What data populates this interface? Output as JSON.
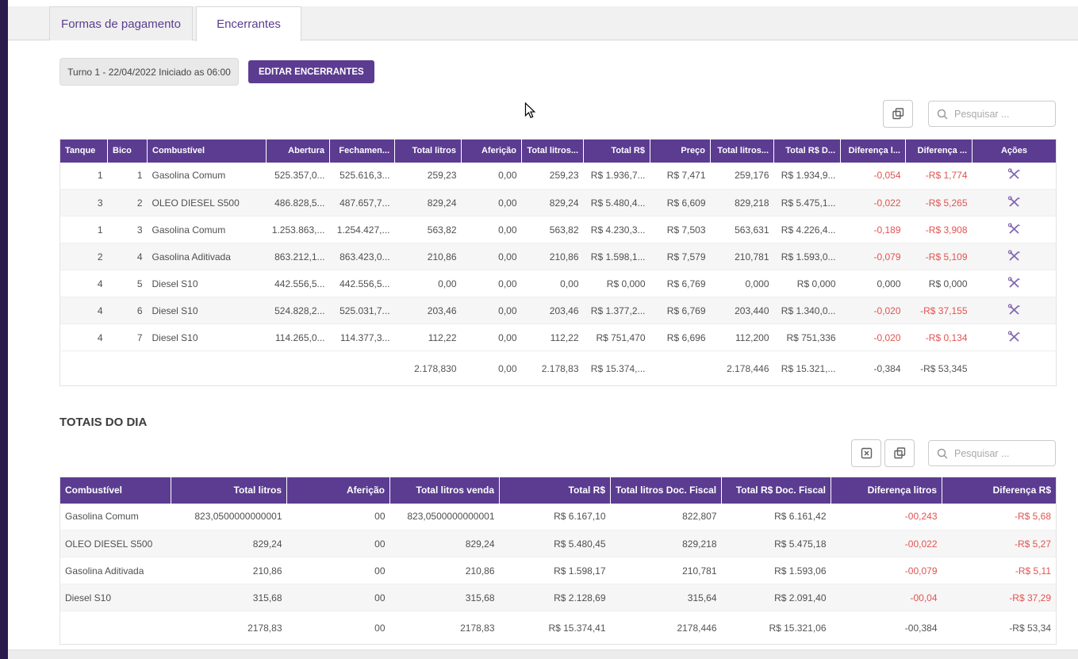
{
  "colors": {
    "accent": "#5b3c91",
    "negative": "#e05450",
    "leftbar": "#2b1b4d"
  },
  "tabs": [
    {
      "label": "Formas de pagamento",
      "active": false
    },
    {
      "label": "Encerrantes",
      "active": true
    }
  ],
  "header": {
    "shift_label": "Turno 1 - 22/04/2022 Iniciado as 06:00",
    "edit_button": "EDITAR ENCERRANTES"
  },
  "search": {
    "placeholder": "Pesquisar ..."
  },
  "icons": {
    "table1_toolbar": [
      "columns-icon"
    ],
    "table2_toolbar": [
      "export-icon",
      "columns-icon"
    ],
    "search": "search-icon",
    "actions": "tools-icon"
  },
  "encerrantes_table": {
    "columns": [
      "Tanque",
      "Bico",
      "Combustível",
      "Abertura",
      "Fechamen...",
      "Total litros",
      "Aferição",
      "Total litros...",
      "Total R$",
      "Preço",
      "Total litros...",
      "Total R$ D...",
      "Diferença l...",
      "Diferença ...",
      "Ações"
    ],
    "rows": [
      [
        "1",
        "1",
        "Gasolina Comum",
        "525.357,0...",
        "525.616,3...",
        "259,23",
        "0,00",
        "259,23",
        "R$ 1.936,7...",
        "R$ 7,471",
        "259,176",
        "R$ 1.934,9...",
        "-0,054",
        "-R$ 1,774"
      ],
      [
        "3",
        "2",
        "OLEO DIESEL S500",
        "486.828,5...",
        "487.657,7...",
        "829,24",
        "0,00",
        "829,24",
        "R$ 5.480,4...",
        "R$ 6,609",
        "829,218",
        "R$ 5.475,1...",
        "-0,022",
        "-R$ 5,265"
      ],
      [
        "1",
        "3",
        "Gasolina Comum",
        "1.253.863,...",
        "1.254.427,...",
        "563,82",
        "0,00",
        "563,82",
        "R$ 4.230,3...",
        "R$ 7,503",
        "563,631",
        "R$ 4.226,4...",
        "-0,189",
        "-R$ 3,908"
      ],
      [
        "2",
        "4",
        "Gasolina Aditivada",
        "863.212,1...",
        "863.423,0...",
        "210,86",
        "0,00",
        "210,86",
        "R$ 1.598,1...",
        "R$ 7,579",
        "210,781",
        "R$ 1.593,0...",
        "-0,079",
        "-R$ 5,109"
      ],
      [
        "4",
        "5",
        "Diesel S10",
        "442.556,5...",
        "442.556,5...",
        "0,00",
        "0,00",
        "0,00",
        "R$ 0,000",
        "R$ 6,769",
        "0,000",
        "R$ 0,000",
        "0,000",
        "R$ 0,000"
      ],
      [
        "4",
        "6",
        "Diesel S10",
        "524.828,2...",
        "525.031,7...",
        "203,46",
        "0,00",
        "203,46",
        "R$ 1.377,2...",
        "R$ 6,769",
        "203,440",
        "R$ 1.340,0...",
        "-0,020",
        "-R$ 37,155"
      ],
      [
        "4",
        "7",
        "Diesel S10",
        "114.265,0...",
        "114.377,3...",
        "112,22",
        "0,00",
        "112,22",
        "R$ 751,470",
        "R$ 6,696",
        "112,200",
        "R$ 751,336",
        "-0,020",
        "-R$ 0,134"
      ]
    ],
    "totals": [
      "",
      "",
      "",
      "",
      "",
      "2.178,830",
      "0,00",
      "2.178,83",
      "R$ 15.374,...",
      "",
      "2.178,446",
      "R$ 15.321,...",
      "-0,384",
      "-R$ 53,345",
      ""
    ]
  },
  "totais_do_dia": {
    "title": "TOTAIS DO DIA",
    "table": {
      "columns": [
        "Combustível",
        "Total litros",
        "Aferição",
        "Total litros venda",
        "Total R$",
        "Total litros Doc. Fiscal",
        "Total R$ Doc. Fiscal",
        "Diferença litros",
        "Diferença R$"
      ],
      "rows": [
        [
          "Gasolina Comum",
          "823,0500000000001",
          "00",
          "823,0500000000001",
          "R$ 6.167,10",
          "822,807",
          "R$ 6.161,42",
          "-00,243",
          "-R$ 5,68"
        ],
        [
          "OLEO DIESEL S500",
          "829,24",
          "00",
          "829,24",
          "R$ 5.480,45",
          "829,218",
          "R$ 5.475,18",
          "-00,022",
          "-R$ 5,27"
        ],
        [
          "Gasolina Aditivada",
          "210,86",
          "00",
          "210,86",
          "R$ 1.598,17",
          "210,781",
          "R$ 1.593,06",
          "-00,079",
          "-R$ 5,11"
        ],
        [
          "Diesel S10",
          "315,68",
          "00",
          "315,68",
          "R$ 2.128,69",
          "315,64",
          "R$ 2.091,40",
          "-00,04",
          "-R$ 37,29"
        ]
      ],
      "totals": [
        "",
        "2178,83",
        "00",
        "2178,83",
        "R$ 15.374,41",
        "2178,446",
        "R$ 15.321,06",
        "-00,384",
        "-R$ 53,34"
      ]
    }
  }
}
